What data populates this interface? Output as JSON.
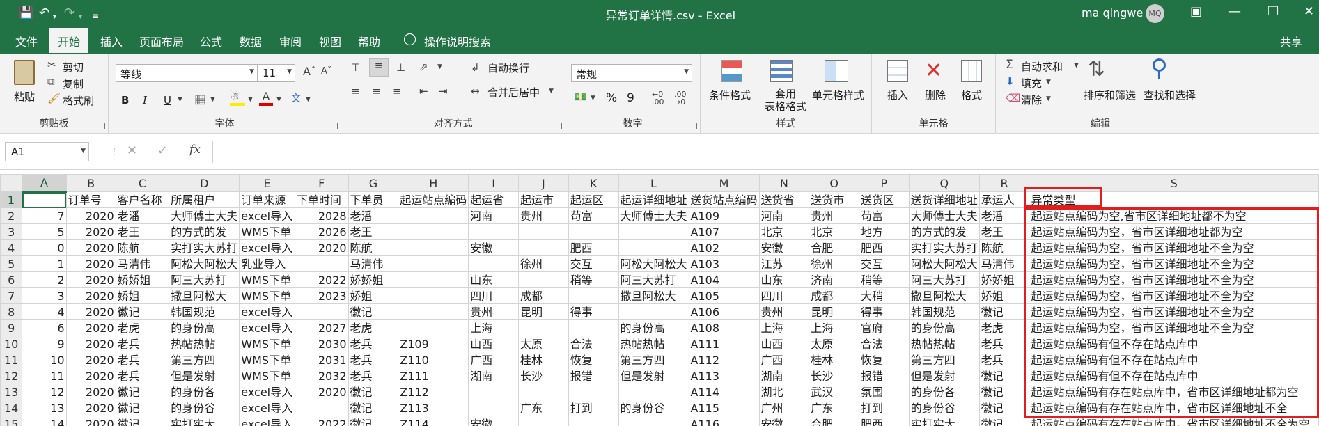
{
  "titlebar": {
    "title": "异常订单详情.csv - Excel",
    "user": "ma qingwe",
    "avatar_initials": "MQ"
  },
  "tabs": [
    {
      "label": "文件"
    },
    {
      "label": "开始"
    },
    {
      "label": "插入"
    },
    {
      "label": "页面布局"
    },
    {
      "label": "公式"
    },
    {
      "label": "数据"
    },
    {
      "label": "审阅"
    },
    {
      "label": "视图"
    },
    {
      "label": "帮助"
    },
    {
      "label": "操作说明搜索"
    }
  ],
  "share": "共享",
  "ribbon": {
    "clipboard": {
      "label": "剪贴板",
      "paste": "粘贴",
      "cut": "剪切",
      "copy": "复制",
      "format_painter": "格式刷"
    },
    "font": {
      "label": "字体",
      "font_name": "等线",
      "font_size": "11",
      "bold": "B",
      "italic": "I",
      "underline": "U"
    },
    "alignment": {
      "label": "对齐方式",
      "wrap": "自动换行",
      "merge": "合并后居中"
    },
    "number": {
      "label": "数字",
      "format": "常规",
      "percent": "%",
      "comma": "9"
    },
    "styles": {
      "label": "样式",
      "conditional": "条件格式",
      "table_format": "套用\n表格格式",
      "cell_styles": "单元格样式"
    },
    "cells": {
      "label": "单元格",
      "insert": "插入",
      "delete": "删除",
      "format": "格式"
    },
    "editing": {
      "label": "编辑",
      "autosum": "自动求和",
      "fill": "填充",
      "clear": "清除",
      "sort_filter": "排序和筛选",
      "find_select": "查找和选择"
    }
  },
  "formula_bar": {
    "name_box": "A1",
    "fx": "fx",
    "content": ""
  },
  "sheet": {
    "columns": [
      "A",
      "B",
      "C",
      "D",
      "E",
      "F",
      "G",
      "H",
      "I",
      "J",
      "K",
      "L",
      "M",
      "N",
      "O",
      "P",
      "Q",
      "R",
      "S"
    ],
    "active_cell": "A1",
    "rows": [
      {
        "n": "1",
        "cells": [
          "",
          "订单号",
          "客户名称",
          "所属租户",
          "订单来源",
          "下单时间",
          "下单员",
          "起运站点编码",
          "起运省",
          "起运市",
          "起运区",
          "起运详细地址",
          "送货站点编码",
          "送货省",
          "送货市",
          "送货区",
          "送货详细地址",
          "承运人",
          "异常类型"
        ]
      },
      {
        "n": "2",
        "cells": [
          "7",
          "2020",
          "老潘",
          "大师傅士大夫",
          "excel导入",
          "2028",
          "老潘",
          "",
          "河南",
          "贵州",
          "苟富",
          "大师傅士大夫",
          "A109",
          "河南",
          "贵州",
          "苟富",
          "大师傅士大夫",
          "老潘",
          "起运站点编码为空,省市区详细地址都不为空"
        ]
      },
      {
        "n": "3",
        "cells": [
          "5",
          "2020",
          "老王",
          "的方式的发",
          "WMS下单",
          "2026",
          "老王",
          "",
          "",
          "",
          "",
          "",
          "A107",
          "北京",
          "北京",
          "地方",
          "的方式的发",
          "老王",
          "起运站点编码为空，省市区详细地址都为空"
        ]
      },
      {
        "n": "4",
        "cells": [
          "0",
          "2020",
          "陈航",
          "实打实大苏打",
          "excel导入",
          "2020",
          "陈航",
          "",
          "安徽",
          "",
          "肥西",
          "",
          "A102",
          "安徽",
          "合肥",
          "肥西",
          "实打实大苏打",
          "陈航",
          "起运站点编码为空，省市区详细地址不全为空"
        ]
      },
      {
        "n": "5",
        "cells": [
          "1",
          "2020",
          "马清伟",
          "阿松大阿松大",
          "乳业导入",
          "",
          "马清伟",
          "",
          "",
          "徐州",
          "交互",
          "阿松大阿松大",
          "A103",
          "江苏",
          "徐州",
          "交互",
          "阿松大阿松大",
          "马清伟",
          "起运站点编码为空，省市区详细地址不全为空"
        ]
      },
      {
        "n": "6",
        "cells": [
          "2",
          "2020",
          "娇娇姐",
          "阿三大苏打",
          "WMS下单",
          "2022",
          "娇娇姐",
          "",
          "山东",
          "",
          "稍等",
          "阿三大苏打",
          "A104",
          "山东",
          "济南",
          "稍等",
          "阿三大苏打",
          "娇娇姐",
          "起运站点编码为空，省市区详细地址不全为空"
        ]
      },
      {
        "n": "7",
        "cells": [
          "3",
          "2020",
          "娇姐",
          "撒旦阿松大",
          "WMS下单",
          "2023",
          "娇姐",
          "",
          "四川",
          "成都",
          "",
          "撒旦阿松大",
          "A105",
          "四川",
          "成都",
          "大稍",
          "撒旦阿松大",
          "娇姐",
          "起运站点编码为空，省市区详细地址不全为空"
        ]
      },
      {
        "n": "8",
        "cells": [
          "4",
          "2020",
          "徽记",
          "韩国规范",
          "excel导入",
          "",
          "徽记",
          "",
          "贵州",
          "昆明",
          "得事",
          "",
          "A106",
          "贵州",
          "昆明",
          "得事",
          "韩国规范",
          "徽记",
          "起运站点编码为空，省市区详细地址不全为空"
        ]
      },
      {
        "n": "9",
        "cells": [
          "6",
          "2020",
          "老虎",
          "的身份高",
          "excel导入",
          "2027",
          "老虎",
          "",
          "上海",
          "",
          "",
          "的身份高",
          "A108",
          "上海",
          "上海",
          "官府",
          "的身份高",
          "老虎",
          "起运站点编码为空，省市区详细地址不全为空"
        ]
      },
      {
        "n": "10",
        "cells": [
          "9",
          "2020",
          "老兵",
          "热帖热帖",
          "WMS下单",
          "2030",
          "老兵",
          "Z109",
          "山西",
          "太原",
          "合法",
          "热帖热帖",
          "A111",
          "山西",
          "太原",
          "合法",
          "热帖热帖",
          "老兵",
          "起运站点编码有但不存在站点库中"
        ]
      },
      {
        "n": "11",
        "cells": [
          "10",
          "2020",
          "老兵",
          "第三方四",
          "WMS下单",
          "2031",
          "老兵",
          "Z110",
          "广西",
          "桂林",
          "恢复",
          "第三方四",
          "A112",
          "广西",
          "桂林",
          "恢复",
          "第三方四",
          "老兵",
          "起运站点编码有但不存在站点库中"
        ]
      },
      {
        "n": "12",
        "cells": [
          "11",
          "2020",
          "老兵",
          "但是发射",
          "WMS下单",
          "2032",
          "老兵",
          "Z111",
          "湖南",
          "长沙",
          "报错",
          "但是发射",
          "A113",
          "湖南",
          "长沙",
          "报错",
          "但是发射",
          "徽记",
          "起运站点编码有但不存在站点库中"
        ]
      },
      {
        "n": "13",
        "cells": [
          "12",
          "2020",
          "徽记",
          "的身份各",
          "excel导入",
          "2020",
          "徽记",
          "Z112",
          "",
          "",
          "",
          "",
          "A114",
          "湖北",
          "武汉",
          "氛围",
          "的身份各",
          "徽记",
          "起运站点编码有存在站点库中，省市区详细地址都为空"
        ]
      },
      {
        "n": "14",
        "cells": [
          "13",
          "2020",
          "徽记",
          "的身份谷",
          "excel导入",
          "",
          "徽记",
          "Z113",
          "",
          "广东",
          "打到",
          "的身份谷",
          "A115",
          "广州",
          "广东",
          "打到",
          "的身份谷",
          "徽记",
          "起运站点编码有存在站点库中，省市区详细地址不全"
        ]
      },
      {
        "n": "15",
        "cells": [
          "14",
          "2020",
          "徽记",
          "实打实大",
          "excel导入",
          "2022",
          "徽记",
          "Z114",
          "安徽",
          "",
          "",
          "",
          "A116",
          "安徽",
          "合肥",
          "肥西",
          "实打实大",
          "徽记",
          "起运站点编码有存在站点库中，省市区详细地址不全为空"
        ]
      }
    ]
  }
}
